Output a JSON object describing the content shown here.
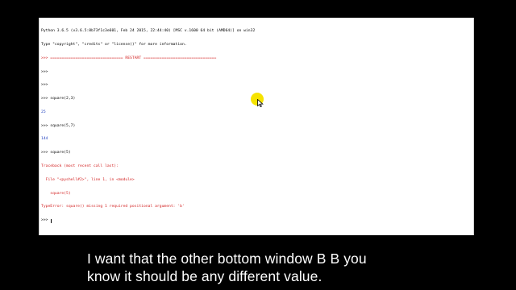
{
  "shell": {
    "lines": [
      {
        "text": "Python 3.6.5 (v3.6.5:8b73f1c3e601, Feb 24 2015, 22:44:40) [MSC v.1600 64 bit (AMD64)] on win32",
        "kind": "out0"
      },
      {
        "text": "Type \"copyright\", \"credits\" or \"license()\" for more information.",
        "kind": "out0"
      },
      {
        "text": ">>> ================================ RESTART ================================",
        "kind": "out0"
      },
      {
        "text": ">>>",
        "kind": "out0"
      },
      {
        "text": ">>>",
        "kind": "out0"
      },
      {
        "text": ">>> square(2,3)",
        "kind": "out0"
      },
      {
        "text": "25",
        "kind": "out"
      },
      {
        "text": ">>> square(5,7)",
        "kind": "out0"
      },
      {
        "text": "144",
        "kind": "out"
      },
      {
        "text": ">>> square(5)",
        "kind": "out0"
      },
      {
        "text": "Traceback (most recent call last):",
        "kind": "err"
      },
      {
        "text": "  File \"<pyshell#2>\", line 1, in <module>",
        "kind": "err"
      },
      {
        "text": "    square(5)",
        "kind": "err"
      },
      {
        "text": "TypeError: square() missing 1 required positional argument: 'b'",
        "kind": "err"
      },
      {
        "text": ">>> ",
        "kind": "prompt"
      }
    ]
  },
  "caption": {
    "line1": "I want that the other bottom window B B you",
    "line2": "know it should be any different value."
  },
  "colors": {
    "output": "#1f3fbf",
    "error": "#d21e1e",
    "highlight": "#f6e300",
    "background": "#000000"
  },
  "icons": {
    "cursor": "mouse-pointer-icon",
    "highlight": "cursor-highlight-circle"
  }
}
